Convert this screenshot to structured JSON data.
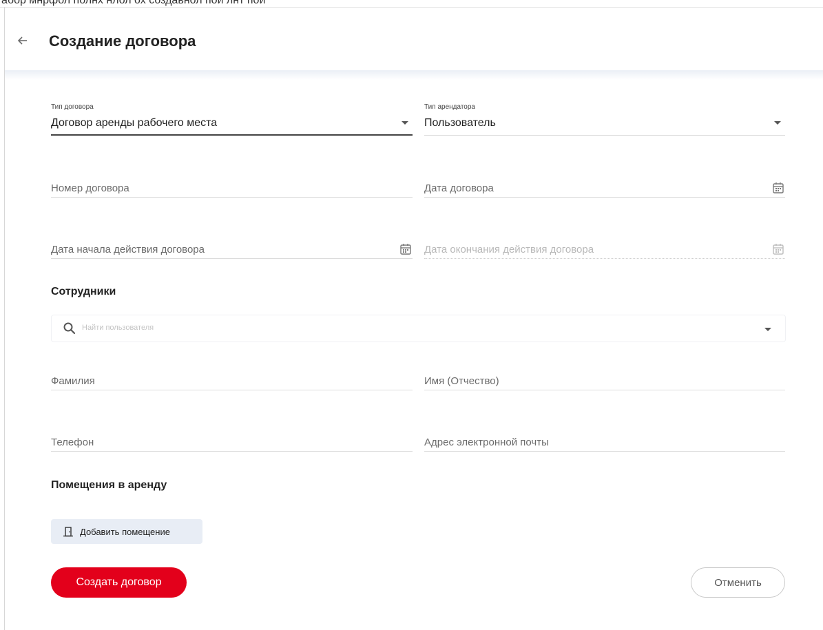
{
  "top_strip_text": "абор мнрфол полнх нлол ох создавнол пой лнт пой",
  "header": {
    "title": "Создание договора"
  },
  "form": {
    "contract_type": {
      "label": "Тип договора",
      "value": "Договор аренды рабочего места"
    },
    "tenant_type": {
      "label": "Тип арендатора",
      "value": "Пользователь"
    },
    "contract_number": {
      "placeholder": "Номер договора"
    },
    "contract_date": {
      "placeholder": "Дата договора"
    },
    "start_date": {
      "placeholder": "Дата начала действия договора"
    },
    "end_date": {
      "placeholder": "Дата окончания действия договора"
    }
  },
  "employees": {
    "title": "Сотрудники",
    "search_placeholder": "Найти пользователя",
    "last_name": {
      "placeholder": "Фамилия"
    },
    "first_name": {
      "placeholder": "Имя (Отчество)"
    },
    "phone": {
      "placeholder": "Телефон"
    },
    "email": {
      "placeholder": "Адрес электронной почты"
    }
  },
  "rooms": {
    "title": "Помещения в аренду",
    "add_button_label": "Добавить помещение"
  },
  "actions": {
    "create_label": "Создать договор",
    "cancel_label": "Отменить"
  },
  "icons": {
    "back": "arrow-left-icon",
    "calendar": "calendar-icon",
    "search": "search-icon",
    "dropdown": "chevron-down-icon",
    "door": "door-icon"
  },
  "colors": {
    "primary": "#e3001b",
    "secondary_button_bg": "#e8edf5"
  }
}
